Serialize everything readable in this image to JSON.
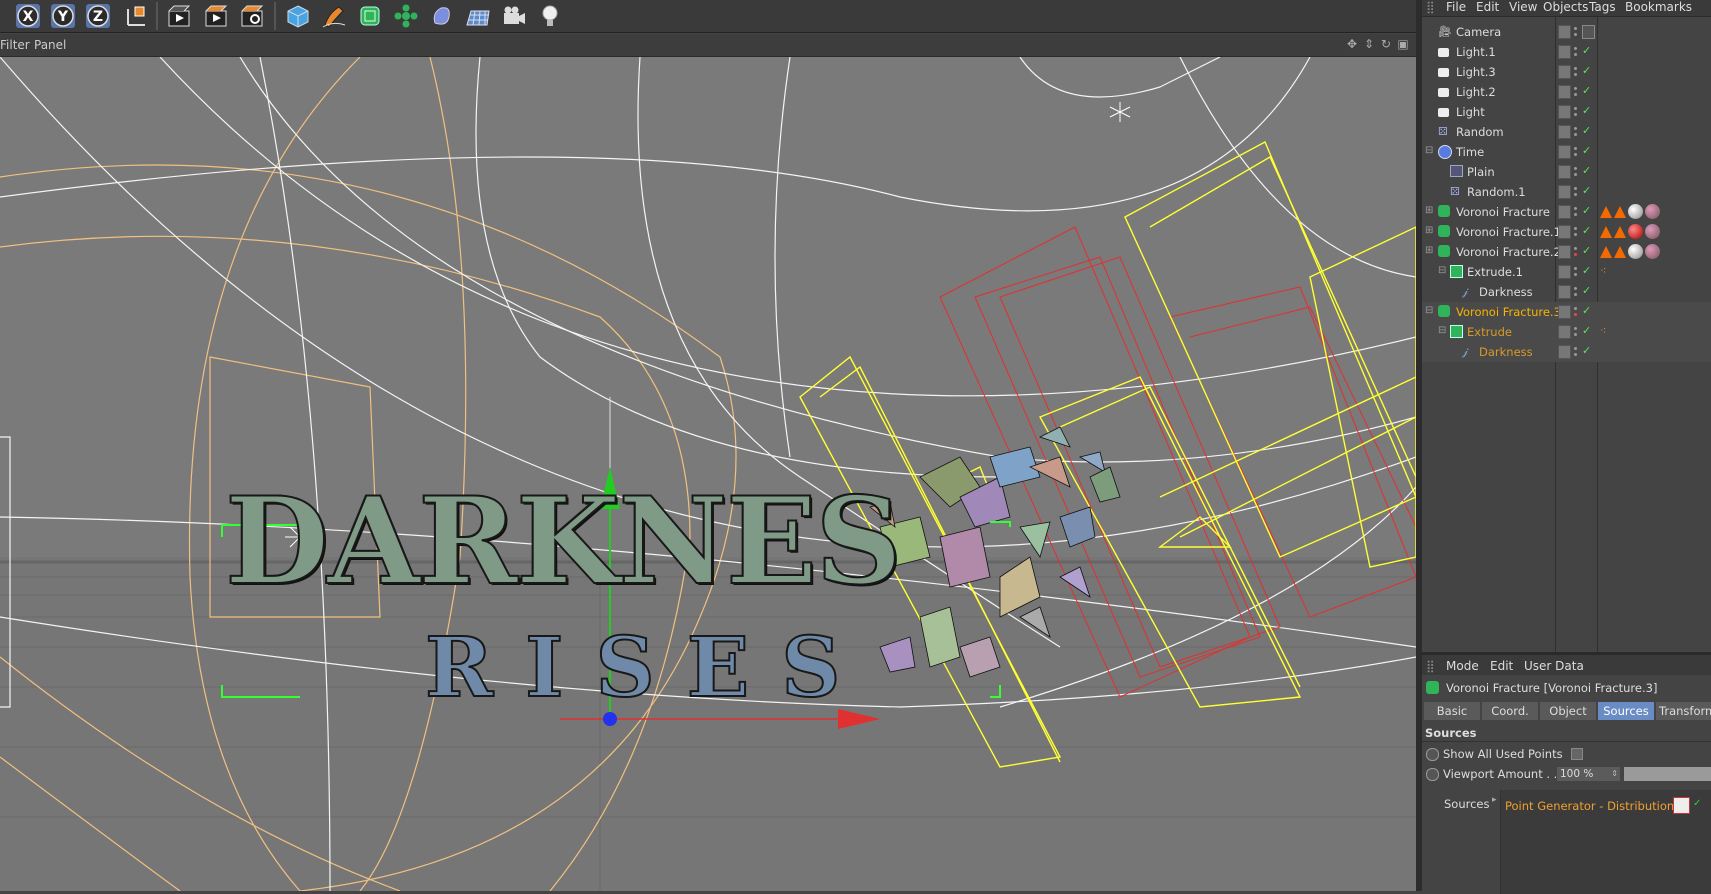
{
  "toolbar": {
    "axis_x": "X",
    "axis_y": "Y",
    "axis_z": "Z",
    "icons": [
      "axis-x-lock",
      "axis-y-lock",
      "axis-z-lock",
      "coordinate-system",
      "render-view",
      "render-to-picture-viewer",
      "render-settings",
      "cube-primitive",
      "pen-spline",
      "subdivision-generator",
      "array-cloner",
      "deformer",
      "floor-environment",
      "camera",
      "light"
    ]
  },
  "viewport_menu": {
    "filter": "Filter",
    "panel": "Panel"
  },
  "viewport_text": {
    "line1": "DARKNES",
    "line2": "RISES"
  },
  "object_manager": {
    "menu": [
      "File",
      "Edit",
      "View",
      "Objects",
      "Tags",
      "Bookmarks"
    ],
    "objects": [
      {
        "name": "Camera",
        "indent": 0,
        "icon": "camera-icon",
        "visible": "dots",
        "tags": [
          "camera-target"
        ]
      },
      {
        "name": "Light.1",
        "indent": 0,
        "icon": "light-icon",
        "visible": "check",
        "tags": []
      },
      {
        "name": "Light.3",
        "indent": 0,
        "icon": "light-icon",
        "visible": "check",
        "tags": []
      },
      {
        "name": "Light.2",
        "indent": 0,
        "icon": "light-icon",
        "visible": "check",
        "tags": []
      },
      {
        "name": "Light",
        "indent": 0,
        "icon": "light-icon",
        "visible": "check",
        "tags": []
      },
      {
        "name": "Random",
        "indent": 0,
        "icon": "random-effector-icon",
        "visible": "check",
        "tags": []
      },
      {
        "name": "Time",
        "indent": 0,
        "icon": "time-effector-icon",
        "visible": "check",
        "tags": [],
        "expand": true
      },
      {
        "name": "Plain",
        "indent": 1,
        "icon": "plain-effector-icon",
        "visible": "check",
        "tags": []
      },
      {
        "name": "Random.1",
        "indent": 1,
        "icon": "random-effector-icon",
        "visible": "check",
        "tags": []
      },
      {
        "name": "Voronoi Fracture",
        "indent": 0,
        "icon": "voronoi-icon",
        "visible": "check",
        "tags": [
          "tri",
          "tri",
          "white",
          "pink"
        ],
        "expand": true
      },
      {
        "name": "Voronoi Fracture.1",
        "indent": 0,
        "icon": "voronoi-icon",
        "visible": "check",
        "tags": [
          "tri",
          "tri",
          "red",
          "pink"
        ],
        "expand": true
      },
      {
        "name": "Voronoi Fracture.2",
        "indent": 0,
        "icon": "voronoi-icon",
        "visible": "check",
        "tags": [
          "tri",
          "tri",
          "white",
          "pink"
        ],
        "expand": true
      },
      {
        "name": "Extrude.1",
        "indent": 1,
        "icon": "extrude-icon",
        "visible": "check",
        "tags": [
          "extrude-tag"
        ],
        "expand": true
      },
      {
        "name": "Darkness",
        "indent": 2,
        "icon": "text-spline-icon",
        "visible": "check",
        "tags": []
      },
      {
        "name": "Voronoi Fracture.3",
        "indent": 0,
        "icon": "voronoi-icon",
        "visible": "check",
        "tags": [],
        "selected": true,
        "expand": true
      },
      {
        "name": "Extrude",
        "indent": 1,
        "icon": "extrude-icon",
        "visible": "check",
        "tags": [
          "extrude-tag"
        ],
        "selected2": true,
        "expand": true
      },
      {
        "name": "Darkness",
        "indent": 2,
        "icon": "text-spline-icon",
        "visible": "check",
        "tags": [],
        "selected2": true
      }
    ]
  },
  "attribute_manager": {
    "menu": [
      "Mode",
      "Edit",
      "User Data"
    ],
    "title": "Voronoi Fracture [Voronoi Fracture.3]",
    "tabs": [
      "Basic",
      "Coord.",
      "Object",
      "Sources",
      "Transform"
    ],
    "active_tab": "Sources",
    "section": "Sources",
    "show_all_used_points": "Show All Used Points",
    "viewport_amount_label": "Viewport Amount . . .",
    "viewport_amount_value": "100 %",
    "sources_label": "Sources",
    "source_item": "Point Generator - Distribution"
  },
  "colors": {
    "viewport_bg": "#7a7a7a",
    "selected_object": "#f7b400",
    "active_tab": "#6a8cc4",
    "grid_lines": "#ffffff",
    "yellow_wire": "#ffff33",
    "red_wire": "#dd2222"
  }
}
